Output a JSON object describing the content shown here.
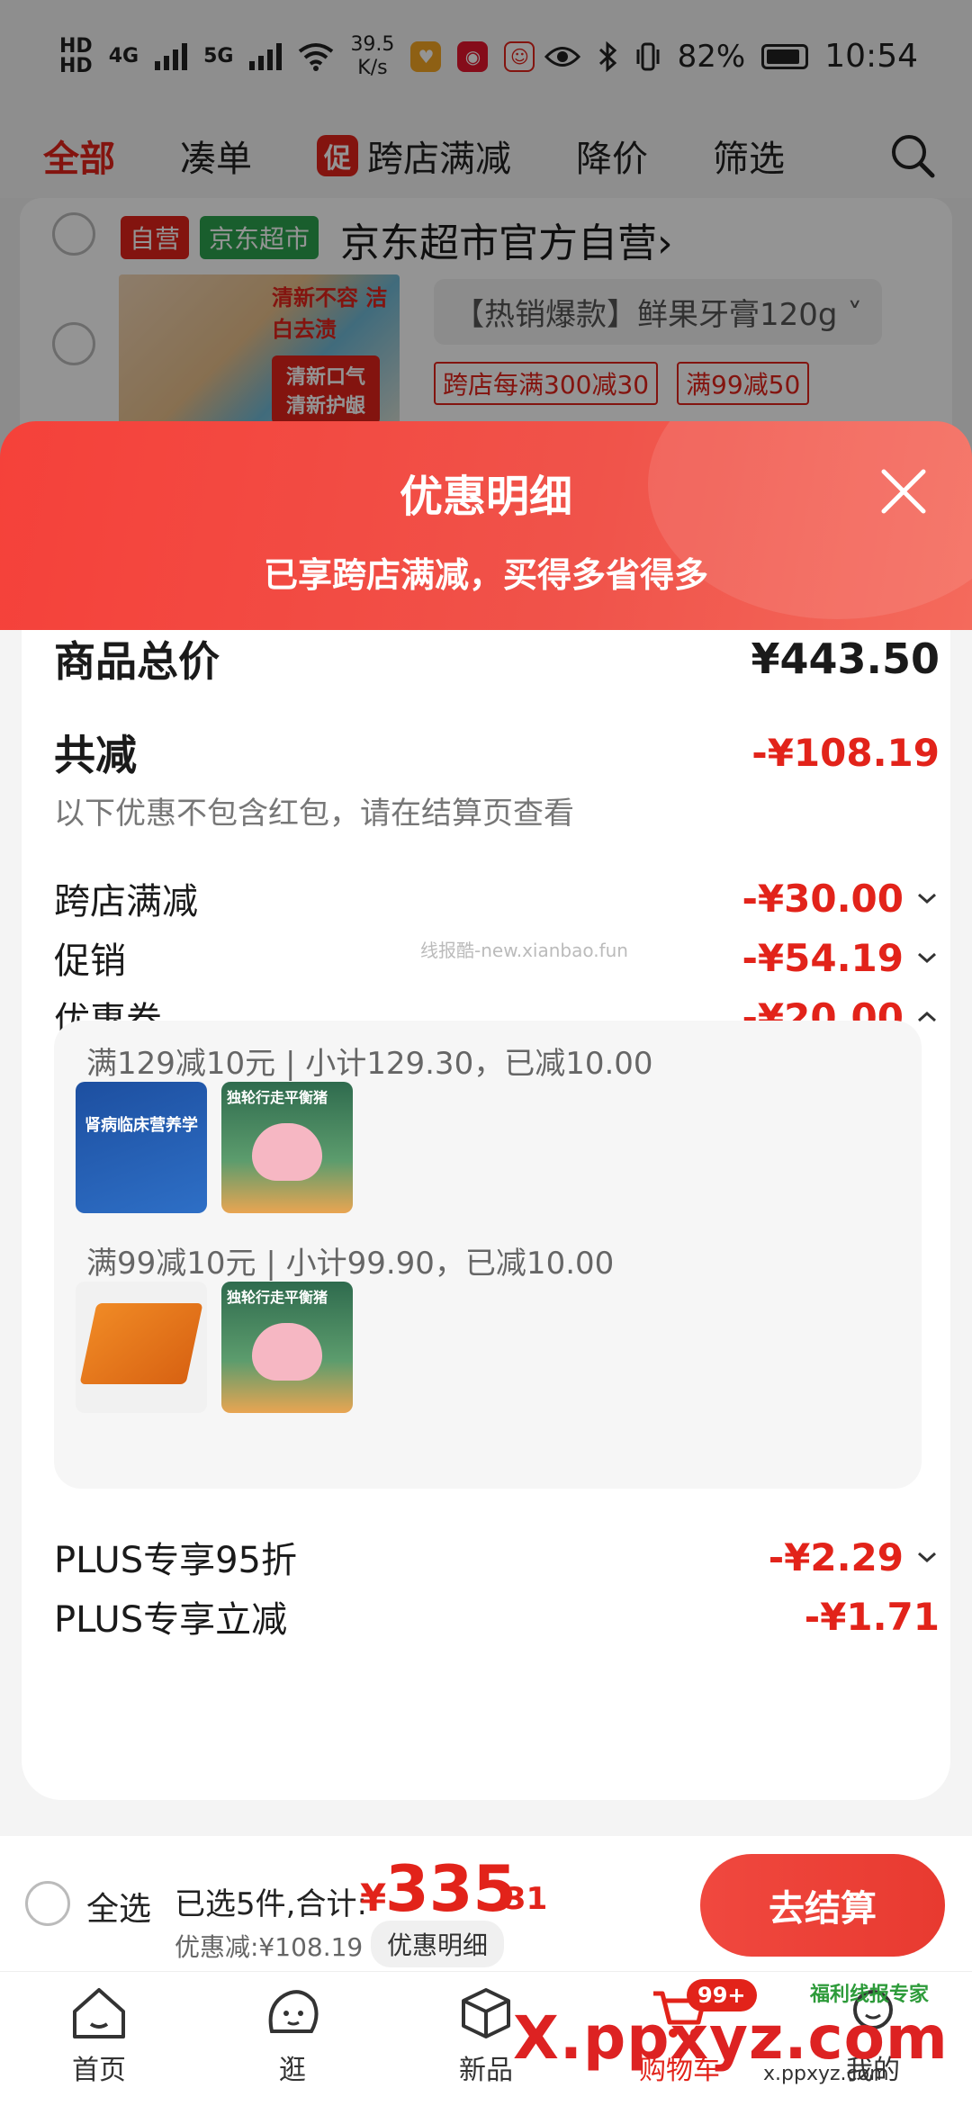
{
  "status_bar": {
    "net1": "HD",
    "net2": "HD",
    "g4": "4G",
    "g5": "5G",
    "speed_value": "39.5",
    "speed_unit": "K/s",
    "battery": "82%",
    "time": "10:54"
  },
  "filter_tabs": [
    {
      "label": "全部",
      "active": true
    },
    {
      "label": "凑单",
      "active": false
    },
    {
      "label": "跨店满减",
      "promo_tag": "促",
      "active": false
    },
    {
      "label": "降价",
      "active": false
    },
    {
      "label": "筛选",
      "active": false
    }
  ],
  "store": {
    "tag_self": "自营",
    "tag_jd": "京东超市",
    "name": "京东超市官方自营",
    "chevron": "›",
    "product_img_text1": "清新不容 洁白去渍",
    "product_img_text2": "清新口气 清新护龈",
    "product_spec": "【热销爆款】鲜果牙膏120g",
    "coupons": [
      "跨店每满300减30",
      "满99减50"
    ]
  },
  "sheet": {
    "title": "优惠明细",
    "subtitle": "已享跨店满减，买得多省得多",
    "total_label": "商品总价",
    "total_value": "¥443.50",
    "discount_label": "共减",
    "discount_value": "-¥108.19",
    "discount_note": "以下优惠不包含红包，请在结算页查看",
    "items": [
      {
        "label": "跨店满减",
        "value": "-¥30.00",
        "chevron": "down"
      },
      {
        "label": "促销",
        "value": "-¥54.19",
        "chevron": "down"
      },
      {
        "label": "优惠券",
        "value": "-¥20.00",
        "chevron": "up"
      }
    ],
    "coupon_groups": [
      {
        "line": "满129减10元 | 小计129.30，已减10.00",
        "thumb1_text": "肾病临床营养学",
        "thumb2_text": "独轮行走平衡猪"
      },
      {
        "line": "满99减10元 | 小计99.90，已减10.00",
        "thumb2_text": "独轮行走平衡猪"
      }
    ],
    "watermark": "线报酷-new.xianbao.fun",
    "plus_items": [
      {
        "label": "PLUS专享95折",
        "value": "-¥2.29",
        "chevron": "down"
      },
      {
        "label": "PLUS专享立减",
        "value": "-¥1.71"
      }
    ]
  },
  "checkout": {
    "select_all": "全选",
    "selected_text": "已选5件,合计:",
    "currency": "¥",
    "total_int": "335",
    "total_dec": ".31",
    "discount_text": "优惠减:¥108.19",
    "detail_button": "优惠明细",
    "checkout_button": "去结算"
  },
  "bottom_nav": [
    {
      "label": "首页",
      "icon": "home-icon"
    },
    {
      "label": "逛",
      "icon": "explore-icon"
    },
    {
      "label": "新品",
      "icon": "new-products-icon"
    },
    {
      "label": "购物车",
      "icon": "cart-icon",
      "badge": "99+",
      "active": true
    },
    {
      "label": "我的",
      "icon": "profile-icon"
    }
  ],
  "watermarks": {
    "big": "X.ppxyz.com",
    "small": "x.ppxyz.com",
    "brand": "福利线报专家"
  },
  "colors": {
    "accent": "#e2231a",
    "header_gradient_start": "#f5413a",
    "green_tag": "#2ca24f"
  }
}
